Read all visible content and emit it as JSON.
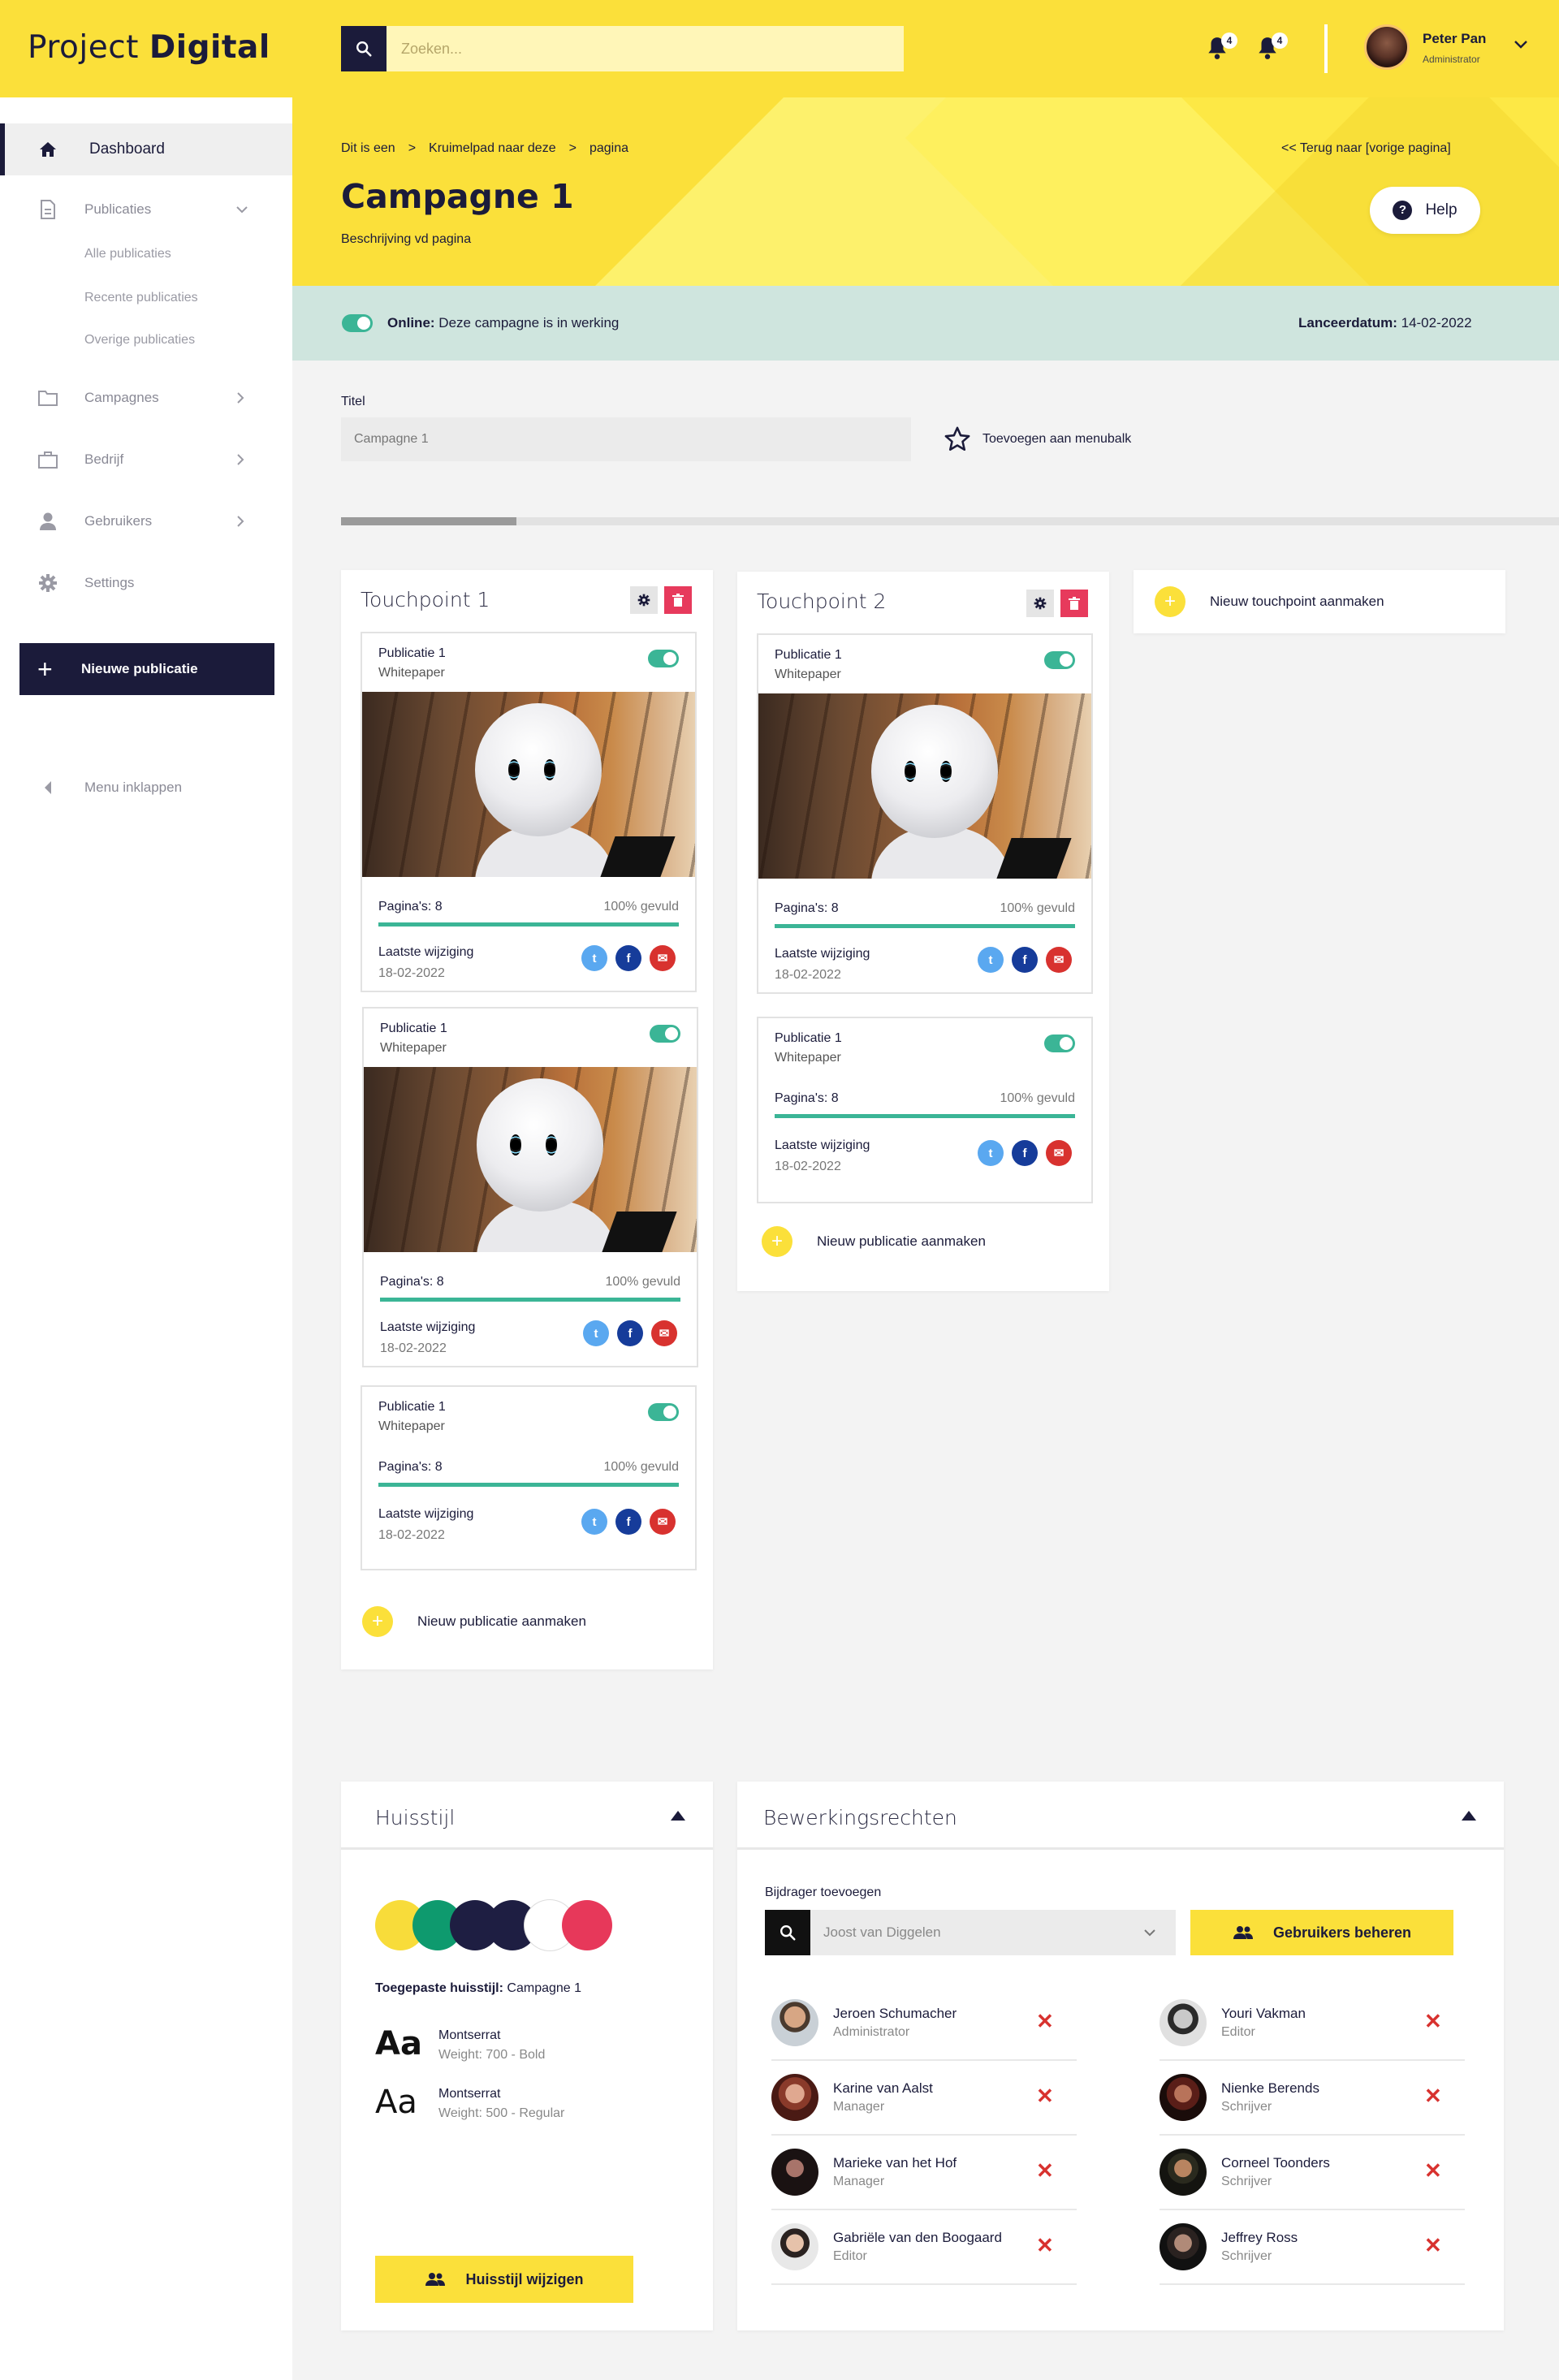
{
  "header": {
    "logo_light": "Project",
    "logo_bold": "Digital",
    "search_placeholder": "Zoeken...",
    "notif1_count": "4",
    "notif2_count": "4",
    "user_name": "Peter Pan",
    "user_role": "Administrator"
  },
  "sidebar": {
    "dashboard": "Dashboard",
    "publicaties": "Publicaties",
    "sub": [
      "Alle publicaties",
      "Recente publicaties",
      "Overige publicaties"
    ],
    "campagnes": "Campagnes",
    "bedrijf": "Bedrijf",
    "gebruikers": "Gebruikers",
    "settings": "Settings",
    "new_pub": "Nieuwe publicatie",
    "collapse": "Menu inklappen"
  },
  "hero": {
    "breadcrumb": [
      "Dit is een",
      ">",
      "Kruimelpad naar deze",
      ">",
      "pagina"
    ],
    "back": "<<  Terug naar [vorige pagina]",
    "title": "Campagne 1",
    "desc": "Beschrijving vd pagina",
    "help": "Help"
  },
  "status": {
    "online_label": "Online:",
    "online_text": "Deze campagne is in werking",
    "launch_label": "Lanceerdatum:",
    "launch_date": "14-02-2022"
  },
  "form": {
    "title_label": "Titel",
    "title_value": "Campagne 1",
    "fav": "Toevoegen aan menubalk"
  },
  "pub": {
    "title": "Publicatie 1",
    "type": "Whitepaper",
    "pages": "Pagina's: 8",
    "filled": "100% gevuld",
    "filled_fraction": 1.0,
    "modified": "Laatste wijziging",
    "date": "18-02-2022"
  },
  "touchpoints": {
    "tp1": "Touchpoint 1",
    "tp2": "Touchpoint 2",
    "new_pub": "Nieuw publicatie aanmaken",
    "new_tp": "Nieuw touchpoint aanmaken"
  },
  "huisstijl": {
    "title": "Huisstijl",
    "colors": [
      "#f8dc3a",
      "#0e9a6e",
      "#1e1e42",
      "#1e1e42",
      "#ffffff",
      "#e7385a"
    ],
    "applied_label": "Toegepaste huisstijl:",
    "applied_value": "Campagne 1",
    "sample": "Aa",
    "fonts": [
      {
        "name": "Montserrat",
        "weight": "Weight: 700 - Bold"
      },
      {
        "name": "Montserrat",
        "weight": "Weight: 500 - Regular"
      }
    ],
    "edit": "Huisstijl wijzigen"
  },
  "rechten": {
    "title": "Bewerkingsrechten",
    "add_label": "Bijdrager toevoegen",
    "select_value": "Joost van Diggelen",
    "manage": "Gebruikers beheren",
    "users_left": [
      {
        "name": "Jeroen Schumacher",
        "role": "Administrator"
      },
      {
        "name": "Karine van Aalst",
        "role": "Manager"
      },
      {
        "name": "Marieke van het Hof",
        "role": "Manager"
      },
      {
        "name": "Gabriële van den Boogaard",
        "role": "Editor"
      }
    ],
    "users_right": [
      {
        "name": "Youri Vakman",
        "role": "Editor"
      },
      {
        "name": "Nienke Berends",
        "role": "Schrijver"
      },
      {
        "name": "Corneel Toonders",
        "role": "Schrijver"
      },
      {
        "name": "Jeffrey Ross",
        "role": "Schrijver"
      }
    ]
  }
}
